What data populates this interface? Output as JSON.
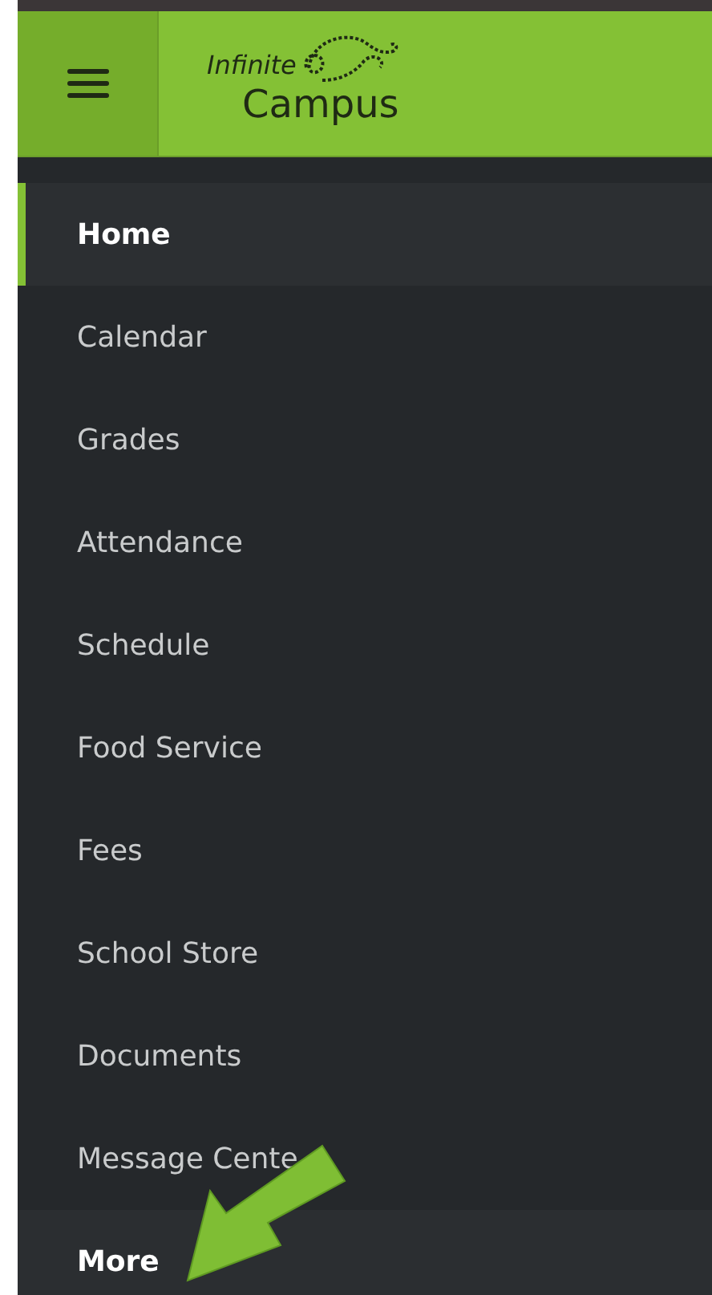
{
  "header": {
    "logo_top": "Infinite",
    "logo_bottom": "Campus"
  },
  "menu": [
    {
      "label": "Home",
      "selected": true
    },
    {
      "label": "Calendar",
      "selected": false
    },
    {
      "label": "Grades",
      "selected": false
    },
    {
      "label": "Attendance",
      "selected": false
    },
    {
      "label": "Schedule",
      "selected": false
    },
    {
      "label": "Food Service",
      "selected": false
    },
    {
      "label": "Fees",
      "selected": false
    },
    {
      "label": "School Store",
      "selected": false
    },
    {
      "label": "Documents",
      "selected": false
    },
    {
      "label": "Message Cente",
      "selected": false
    }
  ],
  "more_item": {
    "label": "More"
  }
}
